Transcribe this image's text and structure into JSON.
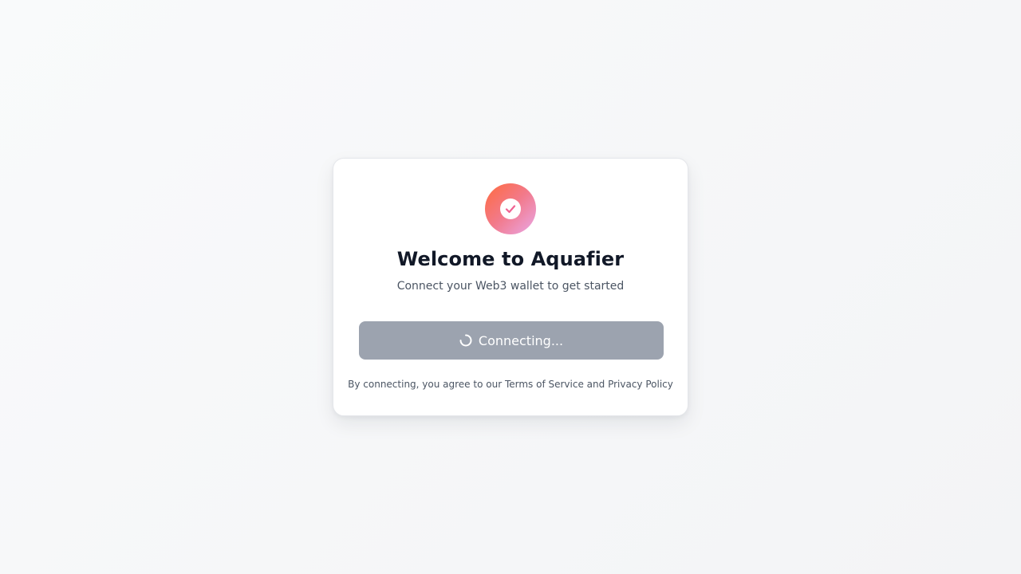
{
  "card": {
    "logo_icon": "check-circle-icon",
    "title": "Welcome to Aquafier",
    "subtitle": "Connect your Web3 wallet to get started",
    "button": {
      "label": "Connecting...",
      "icon": "spinner-icon",
      "state": "disabled"
    },
    "legal": {
      "prefix": "By connecting, you agree to our",
      "terms_link": "Terms of Service",
      "conjunction": "and",
      "privacy_link": "Privacy Policy"
    }
  },
  "colors": {
    "background": "#f6f7f9",
    "card": "#ffffff",
    "logo_gradient": [
      "#ff6a3d",
      "#f27a8c",
      "#e9a8e8"
    ],
    "check": "#f06292",
    "title": "#111827",
    "text_muted": "#4b5563",
    "button_disabled": "#9ca3af"
  }
}
